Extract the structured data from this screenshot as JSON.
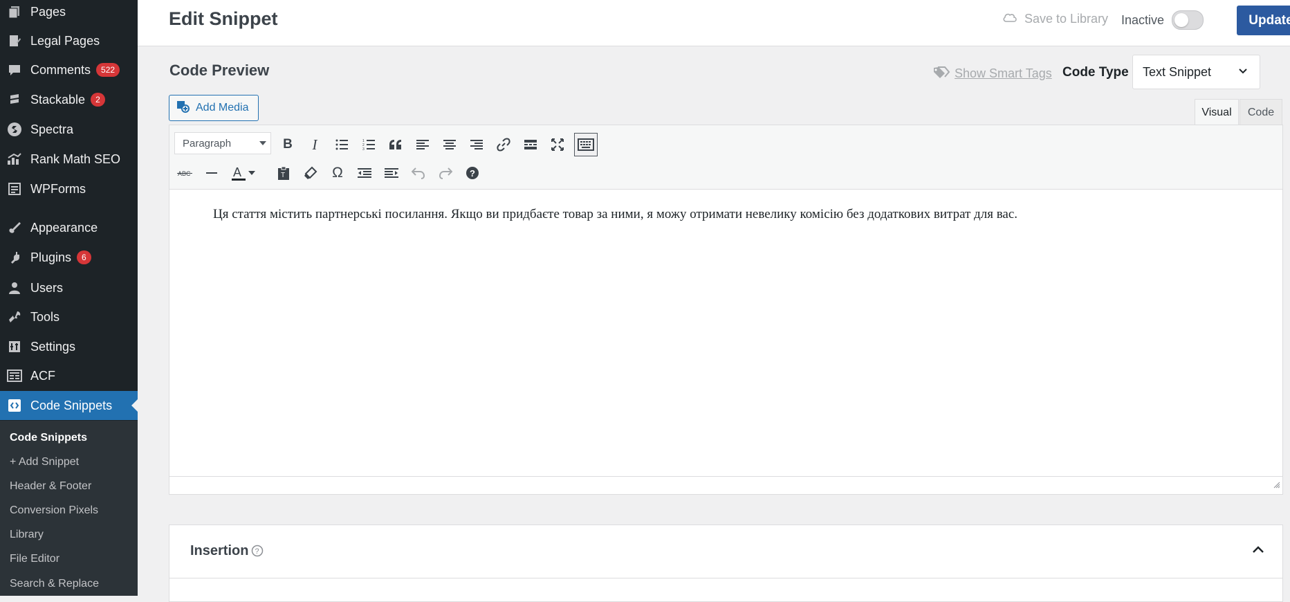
{
  "sidebar": {
    "items": [
      {
        "label": "Pages",
        "icon": "pages-icon",
        "badge": ""
      },
      {
        "label": "Legal Pages",
        "icon": "legal-pages-icon",
        "badge": ""
      },
      {
        "label": "Comments",
        "icon": "comments-icon",
        "badge": "522"
      },
      {
        "label": "Stackable",
        "icon": "stackable-icon",
        "badge": "2"
      },
      {
        "label": "Spectra",
        "icon": "spectra-icon",
        "badge": ""
      },
      {
        "label": "Rank Math SEO",
        "icon": "rank-math-icon",
        "badge": ""
      },
      {
        "label": "WPForms",
        "icon": "wpforms-icon",
        "badge": ""
      },
      {
        "label": "Appearance",
        "icon": "appearance-icon",
        "badge": ""
      },
      {
        "label": "Plugins",
        "icon": "plugins-icon",
        "badge": "6"
      },
      {
        "label": "Users",
        "icon": "users-icon",
        "badge": ""
      },
      {
        "label": "Tools",
        "icon": "tools-icon",
        "badge": ""
      },
      {
        "label": "Settings",
        "icon": "settings-icon",
        "badge": ""
      },
      {
        "label": "ACF",
        "icon": "acf-icon",
        "badge": ""
      },
      {
        "label": "Code Snippets",
        "icon": "code-snippets-icon",
        "badge": ""
      }
    ],
    "submenu": [
      "Code Snippets",
      "+ Add Snippet",
      "Header & Footer",
      "Conversion Pixels",
      "Library",
      "File Editor",
      "Search & Replace"
    ]
  },
  "header": {
    "title": "Edit Snippet",
    "save_to_library": "Save to Library",
    "status": "Inactive",
    "update": "Update"
  },
  "code_preview": {
    "title": "Code Preview",
    "show_smart_tags": "Show Smart Tags",
    "code_type_label": "Code Type",
    "code_type_value": "Text Snippet",
    "add_media": "Add Media",
    "tabs": [
      "Visual",
      "Code"
    ],
    "format": "Paragraph",
    "content": "Ця стаття містить партнерські посилання. Якщо ви придбаєте товар за ними, я можу отримати невелику комісію без додаткових витрат для вас."
  },
  "insertion": {
    "title": "Insertion"
  },
  "colors": {
    "sidebar_bg": "#1d2327",
    "active_blue": "#2271b1",
    "update_button": "#2c5aa0",
    "badge_red": "#d63638"
  }
}
